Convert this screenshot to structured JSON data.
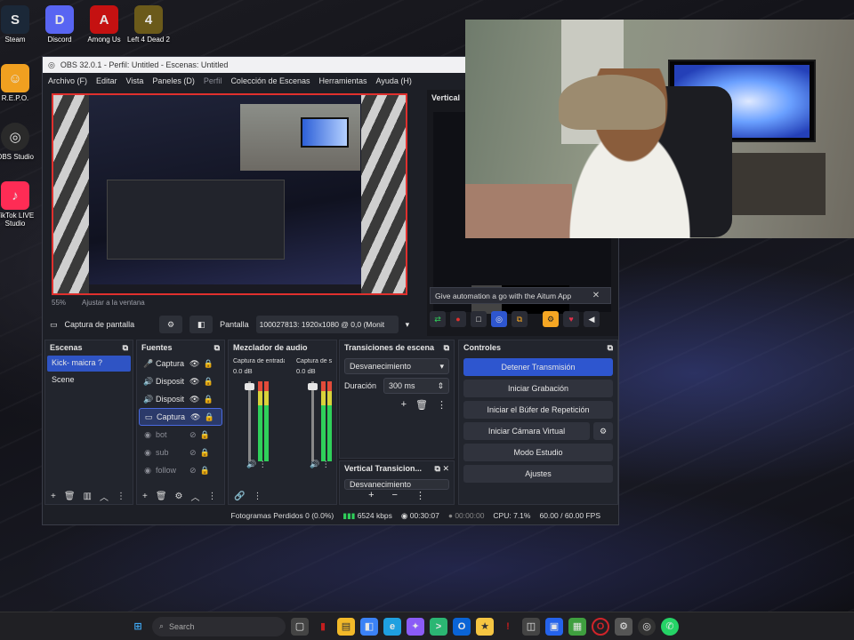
{
  "desktop": {
    "icons": [
      {
        "label": "Steam",
        "color": "#1b2838",
        "glyph": "S"
      },
      {
        "label": "Discord",
        "color": "#5865f2",
        "glyph": "D"
      },
      {
        "label": "Among Us",
        "color": "#c51111",
        "glyph": "A"
      },
      {
        "label": "Left 4 Dead 2",
        "color": "#6b5a1a",
        "glyph": "4"
      },
      {
        "label": "R.E.P.O.",
        "color": "#f0a020",
        "glyph": "☺"
      },
      {
        "label": "OBS Studio",
        "color": "#2a2a2a",
        "glyph": "◎"
      },
      {
        "label": "TikTok LIVE Studio",
        "color": "#fe2c55",
        "glyph": "♪"
      }
    ]
  },
  "obs": {
    "title": "OBS 32.0.1 - Perfil: Untitled - Escenas: Untitled",
    "menu": [
      "Archivo (F)",
      "Editar",
      "Vista",
      "Paneles (D)",
      "Perfil",
      "Colección de Escenas",
      "Herramientas",
      "Ayuda (H)"
    ],
    "zoom": "55%",
    "fit_label": "Ajustar a la ventana",
    "vertical_title": "Vertical",
    "automation_text": "Give automation a go with the Aitum App",
    "source_bar": {
      "source_name": "Captura de pantalla",
      "display_label": "Pantalla",
      "display_value": "100027813: 1920x1080 @ 0,0 (Monit"
    },
    "scenes": {
      "title": "Escenas",
      "items": [
        "Kick- maicra ?",
        "Scene"
      ]
    },
    "sources": {
      "title": "Fuentes",
      "items": [
        {
          "name": "Captura",
          "icon": "🎤",
          "active": true
        },
        {
          "name": "Disposit",
          "icon": "🔊",
          "active": true
        },
        {
          "name": "Disposit",
          "icon": "🔊",
          "active": true
        },
        {
          "name": "Captura",
          "icon": "▭",
          "active": true
        },
        {
          "name": "bot",
          "icon": "◉",
          "active": false
        },
        {
          "name": "sub",
          "icon": "◉",
          "active": false
        },
        {
          "name": "follow",
          "icon": "◉",
          "active": false
        }
      ]
    },
    "mixer": {
      "title": "Mezclador de audio",
      "channels": [
        {
          "name": "Captura de entrada",
          "db": "0.0 dB"
        },
        {
          "name": "Captura de s",
          "db": "0.0 dB"
        }
      ]
    },
    "transitions": {
      "title": "Transiciones de escena",
      "selected": "Desvanecimiento",
      "duration_label": "Duración",
      "duration_value": "300 ms"
    },
    "vertical_transitions": {
      "title": "Vertical Transicion...",
      "selected": "Desvanecimiento"
    },
    "controls": {
      "title": "Controles",
      "buttons": [
        "Detener Transmisión",
        "Iniciar Grabación",
        "Iniciar el Búfer de Repetición",
        "Iniciar Cámara Virtual",
        "Modo Estudio",
        "Ajustes"
      ]
    },
    "status": {
      "dropped": "Fotogramas Perdidos 0 (0.0%)",
      "bitrate": "6524 kbps",
      "stream_time": "00:30:07",
      "rec_time": "00:00:00",
      "cpu": "CPU: 7.1%",
      "fps": "60.00 / 60.00 FPS"
    }
  },
  "taskbar": {
    "search_placeholder": "Search",
    "apps": [
      {
        "name": "file-explorer",
        "color": "#f2b929",
        "glyph": "▤"
      },
      {
        "name": "microsoft-store",
        "color": "#3b82f6",
        "glyph": "◧"
      },
      {
        "name": "edge",
        "color": "#1fa0e0",
        "glyph": "e"
      },
      {
        "name": "copilot",
        "color": "#8b5cf6",
        "glyph": "✦"
      },
      {
        "name": "terminal",
        "color": "#2bb673",
        "glyph": ">"
      },
      {
        "name": "outlook",
        "color": "#0a64d6",
        "glyph": "O"
      },
      {
        "name": "brawl",
        "color": "#f5c542",
        "glyph": "★"
      },
      {
        "name": "app-red",
        "color": "#c41e1e",
        "glyph": "!"
      },
      {
        "name": "capture",
        "color": "#444",
        "glyph": "◫"
      },
      {
        "name": "remote",
        "color": "#2563eb",
        "glyph": "▣"
      },
      {
        "name": "minecraft",
        "color": "#3f9f3f",
        "glyph": "▦"
      },
      {
        "name": "opera",
        "color": "#d0242a",
        "glyph": "O"
      },
      {
        "name": "settings",
        "color": "#555",
        "glyph": "⚙"
      },
      {
        "name": "obs",
        "color": "#333",
        "glyph": "◎"
      },
      {
        "name": "whatsapp",
        "color": "#25d366",
        "glyph": "✆"
      }
    ]
  }
}
